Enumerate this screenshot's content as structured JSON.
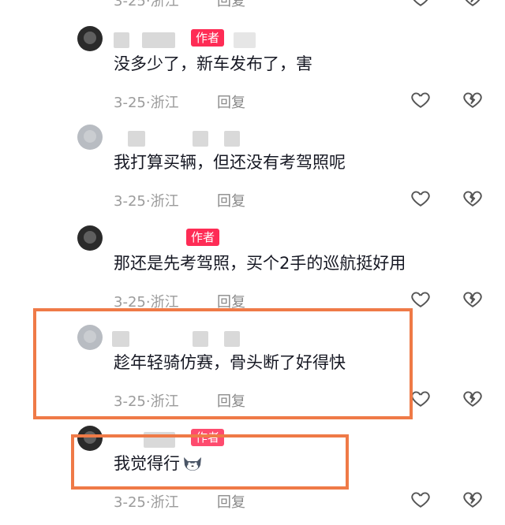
{
  "comments": [
    {
      "id": "c0",
      "content": "",
      "date": "3-25",
      "location": "浙江",
      "reply_label": "回复",
      "is_author": false
    },
    {
      "id": "c1",
      "content": "没多少了，新车发布了，害",
      "date": "3-25",
      "location": "浙江",
      "reply_label": "回复",
      "is_author": true,
      "author_tag": "作者"
    },
    {
      "id": "c2",
      "content": "我打算买辆，但还没有考驾照呢",
      "date": "3-25",
      "location": "浙江",
      "reply_label": "回复",
      "is_author": false
    },
    {
      "id": "c3",
      "content": "那还是先考驾照，买个2手的巡航挺好用",
      "date": "3-25",
      "location": "浙江",
      "reply_label": "回复",
      "is_author": true,
      "author_tag": "作者"
    },
    {
      "id": "c4",
      "content": "趁年轻骑仿赛，骨头断了好得快",
      "date": "3-25",
      "location": "浙江",
      "reply_label": "回复",
      "is_author": false
    },
    {
      "id": "c5",
      "content": "我觉得行",
      "date": "3-25",
      "location": "浙江",
      "reply_label": "回复",
      "is_author": true,
      "author_tag": "作者",
      "emoji": "cat-face-emoji"
    }
  ],
  "meta_separator": "·",
  "icons": {
    "like": "heart-outline-icon",
    "dislike": "broken-heart-icon"
  },
  "colors": {
    "author_tag": "#fe2c55",
    "highlight_box": "#ef7a47",
    "meta_text": "#9b9b9b"
  }
}
